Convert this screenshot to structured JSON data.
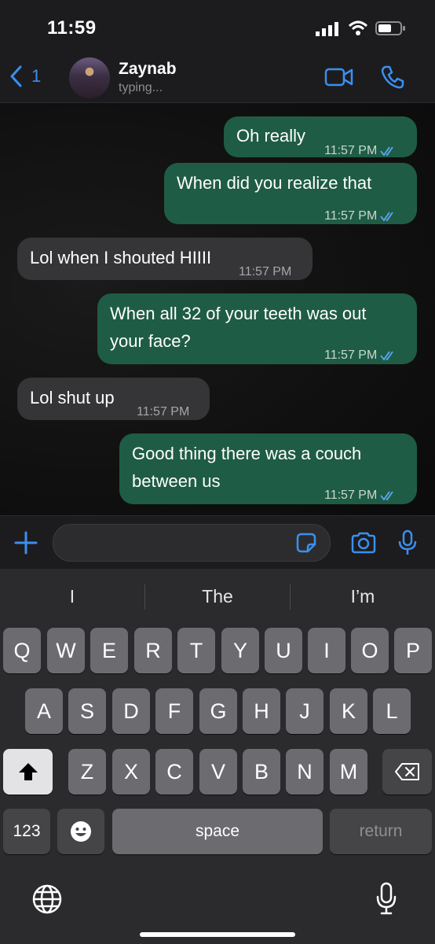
{
  "status": {
    "time": "11:59"
  },
  "header": {
    "back_count": "1",
    "contact_name": "Zaynab",
    "contact_status": "typing..."
  },
  "messages": [
    {
      "dir": "out",
      "text": "Oh really",
      "time": "11:57 PM"
    },
    {
      "dir": "out",
      "text": "When did you realize that",
      "time": "11:57 PM"
    },
    {
      "dir": "in",
      "text": "Lol when I shouted HIIII",
      "time": "11:57 PM"
    },
    {
      "dir": "out",
      "text": "When all 32 of your teeth was out",
      "text2": "your face?",
      "time": "11:57 PM"
    },
    {
      "dir": "in",
      "text": "Lol shut up",
      "time": "11:57 PM"
    },
    {
      "dir": "out",
      "text": "Good thing there was a couch",
      "text2": "between us",
      "time": "11:57 PM"
    }
  ],
  "suggestions": [
    "I",
    "The",
    "I’m"
  ],
  "keys": {
    "row1": [
      "Q",
      "W",
      "E",
      "R",
      "T",
      "Y",
      "U",
      "I",
      "O",
      "P"
    ],
    "row2": [
      "A",
      "S",
      "D",
      "F",
      "G",
      "H",
      "J",
      "K",
      "L"
    ],
    "row3": [
      "Z",
      "X",
      "C",
      "V",
      "B",
      "N",
      "M"
    ],
    "numbers": "123",
    "space": "space",
    "return": "return"
  },
  "colors": {
    "accent": "#3b8fef",
    "outgoing_bubble": "#1f5c45",
    "incoming_bubble": "#353537"
  },
  "icons": [
    "signal-icon",
    "wifi-icon",
    "battery-icon",
    "back-chevron-icon",
    "video-call-icon",
    "phone-icon",
    "plus-icon",
    "sticker-icon",
    "camera-icon",
    "mic-icon",
    "shift-icon",
    "backspace-icon",
    "emoji-icon",
    "globe-icon",
    "dictation-icon"
  ]
}
